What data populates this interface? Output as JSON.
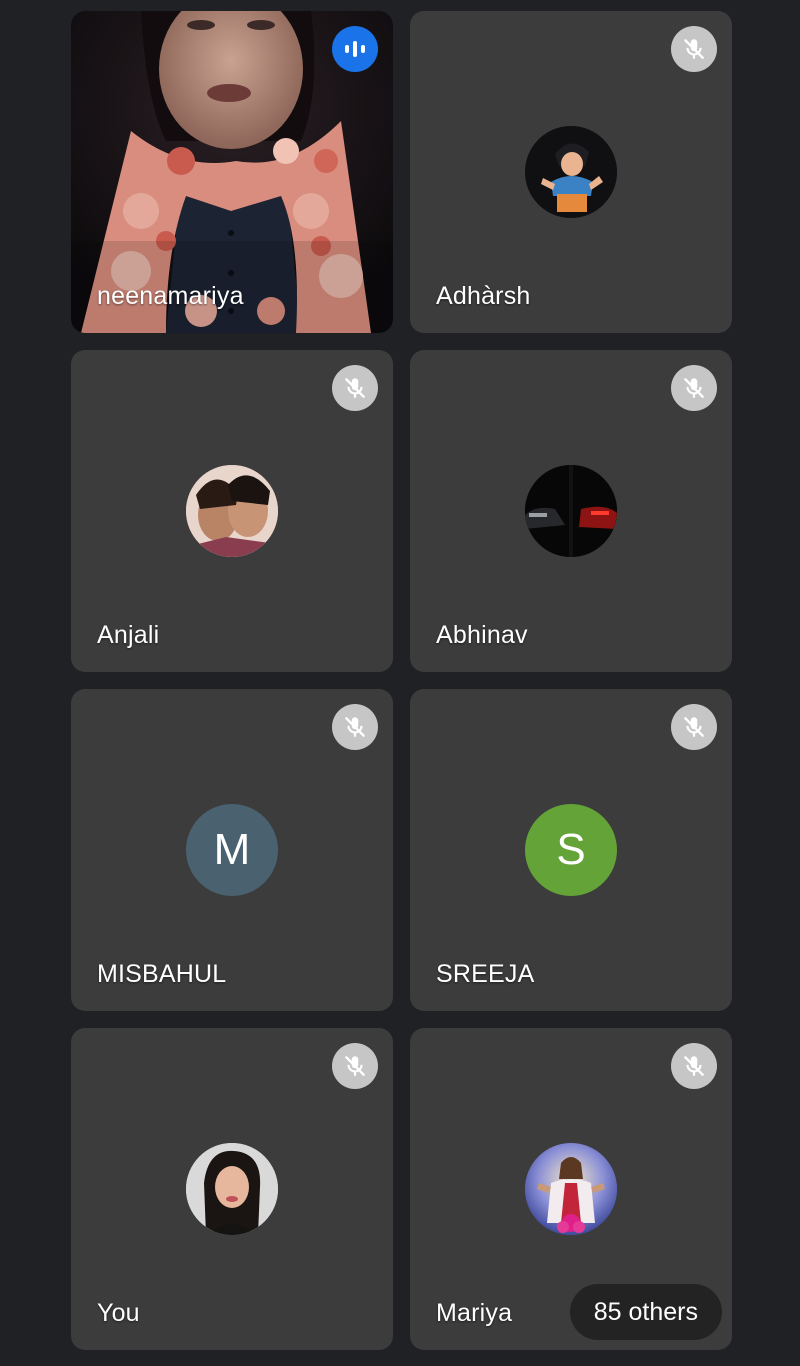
{
  "participants": [
    {
      "name": "neenamariya",
      "status": "speaking",
      "media": "video"
    },
    {
      "name": "Adhàrsh",
      "status": "muted",
      "media": "photo-cartoon"
    },
    {
      "name": "Anjali",
      "status": "muted",
      "media": "photo-selfie"
    },
    {
      "name": "Abhinav",
      "status": "muted",
      "media": "photo-cars"
    },
    {
      "name": "MISBAHUL",
      "status": "muted",
      "media": "letter",
      "initial": "M",
      "avatar_color": "#4a6170"
    },
    {
      "name": "SREEJA",
      "status": "muted",
      "media": "letter",
      "initial": "S",
      "avatar_color": "#64a337"
    },
    {
      "name": "You",
      "status": "muted",
      "media": "photo-portrait"
    },
    {
      "name": "Mariya",
      "status": "muted",
      "media": "photo-religious"
    }
  ],
  "others_label": "85 others",
  "icons": {
    "muted": "mic-off-icon",
    "speaking": "audio-level-icon"
  },
  "colors": {
    "background": "#202124",
    "tile": "#3c3c3c",
    "speaking_accent": "#1a73e8",
    "mute_badge": "#c6c6c6"
  }
}
